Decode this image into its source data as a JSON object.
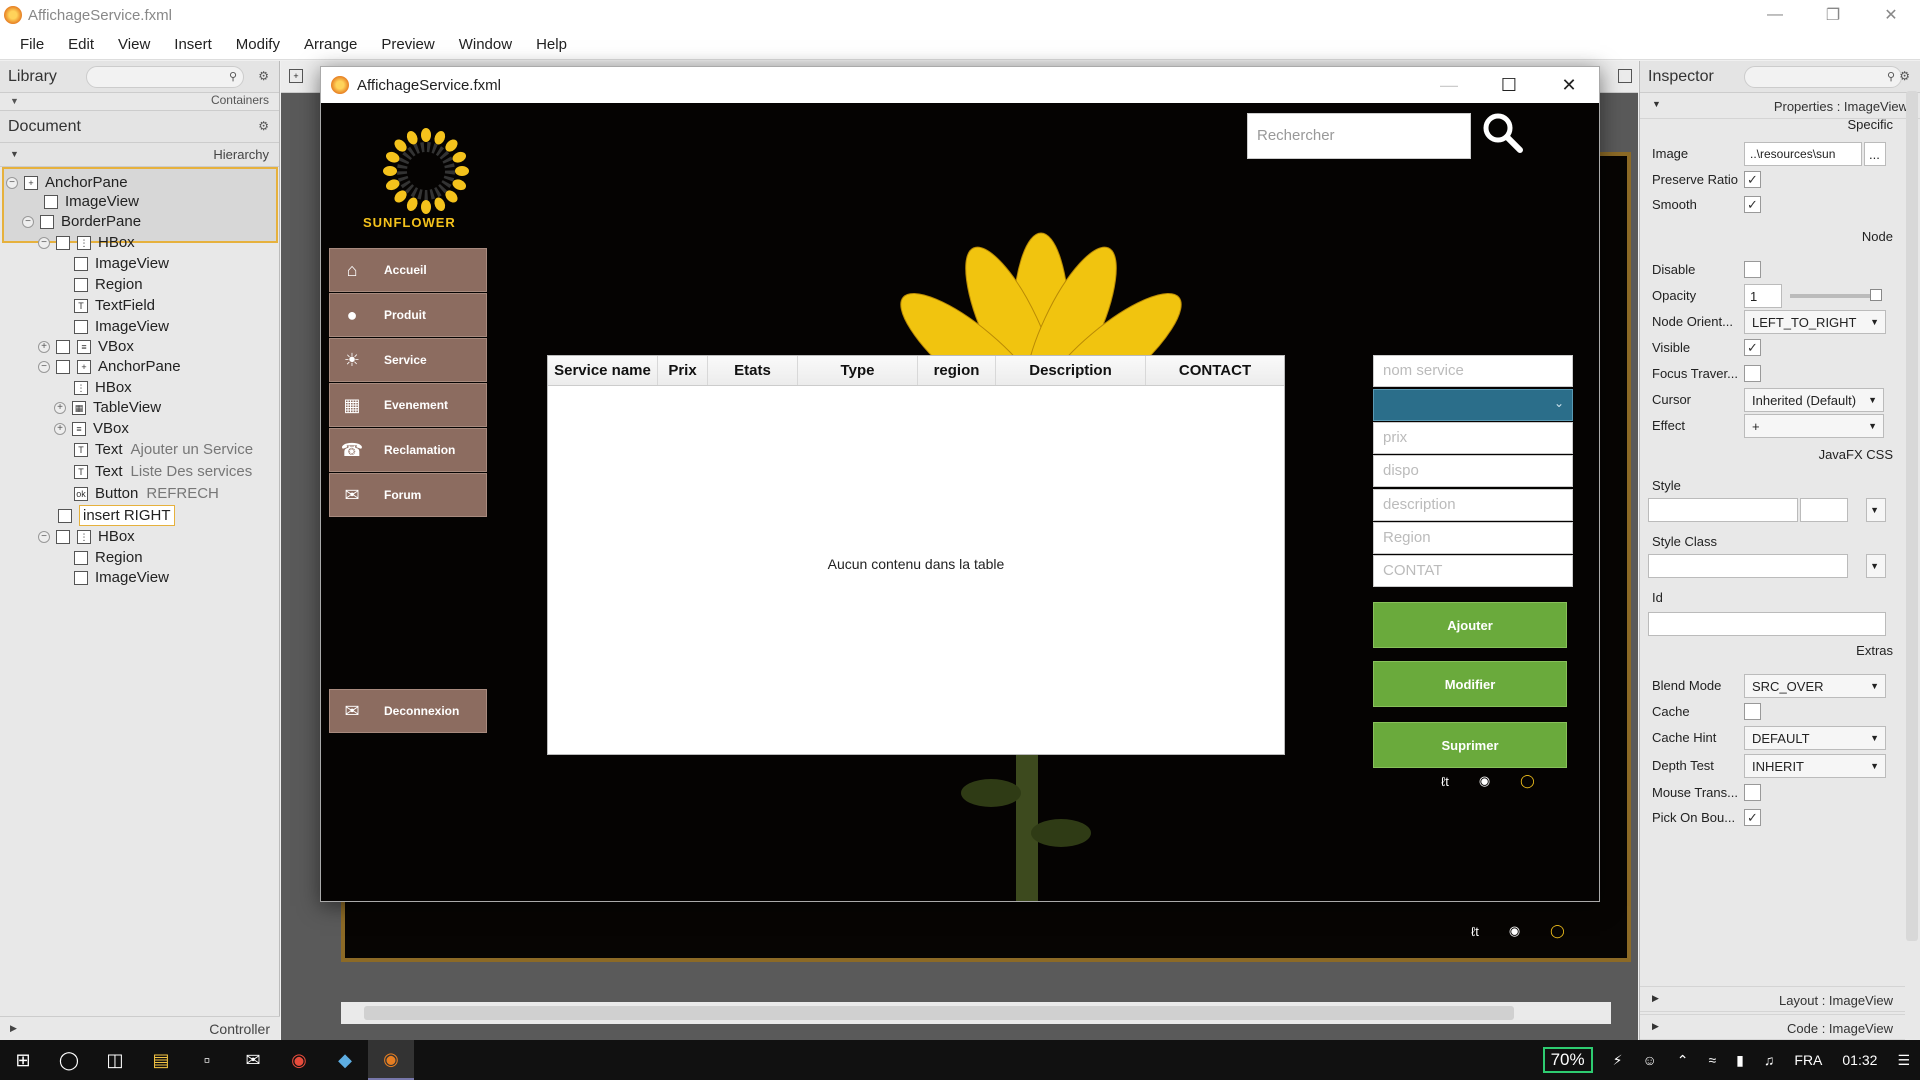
{
  "window": {
    "title": "AffichageService.fxml"
  },
  "menu": [
    "File",
    "Edit",
    "View",
    "Insert",
    "Modify",
    "Arrange",
    "Preview",
    "Window",
    "Help"
  ],
  "library": {
    "title": "Library",
    "sub": "Containers"
  },
  "document": {
    "title": "Document",
    "hierarchy_label": "Hierarchy",
    "tree": [
      {
        "label": "AnchorPane",
        "sub": ""
      },
      {
        "label": "ImageView",
        "sub": ""
      },
      {
        "label": "BorderPane",
        "sub": ""
      },
      {
        "label": "HBox",
        "sub": ""
      },
      {
        "label": "ImageView",
        "sub": ""
      },
      {
        "label": "Region",
        "sub": ""
      },
      {
        "label": "TextField",
        "sub": ""
      },
      {
        "label": "ImageView",
        "sub": ""
      },
      {
        "label": "VBox",
        "sub": ""
      },
      {
        "label": "AnchorPane",
        "sub": ""
      },
      {
        "label": "HBox",
        "sub": ""
      },
      {
        "label": "TableView",
        "sub": ""
      },
      {
        "label": "VBox",
        "sub": ""
      },
      {
        "label": "Text",
        "sub": "Ajouter un Service"
      },
      {
        "label": "Text",
        "sub": "Liste Des services"
      },
      {
        "label": "Button",
        "sub": "REFRECH"
      },
      {
        "label": "insert RIGHT",
        "sub": ""
      },
      {
        "label": "HBox",
        "sub": ""
      },
      {
        "label": "Region",
        "sub": ""
      },
      {
        "label": "ImageView",
        "sub": ""
      }
    ],
    "controller_label": "Controller"
  },
  "preview": {
    "title": "AffichageService.fxml",
    "logo_text": "SUNFLOWER",
    "search_placeholder": "Rechercher",
    "nav": [
      "Accueil",
      "Produit",
      "Service",
      "Evenement",
      "Reclamation",
      "Forum"
    ],
    "logout": "Deconnexion",
    "table": {
      "columns": [
        "Service name",
        "Prix",
        "Etats",
        "Type",
        "region",
        "Description",
        "CONTACT"
      ],
      "empty_message": "Aucun contenu dans la table"
    },
    "form": {
      "placeholders": [
        "nom service",
        "prix",
        "dispo",
        "description",
        "Region",
        "CONTAT"
      ]
    },
    "actions": [
      "Ajouter",
      "Modifier",
      "Suprimer"
    ],
    "colors": {
      "nav": "#8c6c60",
      "action": "#6aaa3c",
      "combo": "#2b6e8a",
      "accent": "#f4c21c"
    }
  },
  "inspector": {
    "title": "Inspector",
    "properties_header": "Properties : ImageView",
    "specific": "Specific",
    "image_label": "Image",
    "image_value": "..\\resources\\sun",
    "preserve_ratio": "Preserve Ratio",
    "smooth": "Smooth",
    "node": "Node",
    "disable": "Disable",
    "opacity": "Opacity",
    "opacity_value": "1",
    "node_orientation": "Node Orient...",
    "node_orientation_value": "LEFT_TO_RIGHT",
    "visible": "Visible",
    "focus": "Focus Traver...",
    "cursor": "Cursor",
    "cursor_value": "Inherited (Default)",
    "effect": "Effect",
    "effect_value": "+",
    "javafx_css": "JavaFX CSS",
    "style": "Style",
    "style_class": "Style Class",
    "id": "Id",
    "extras": "Extras",
    "blend_mode": "Blend Mode",
    "blend_mode_value": "SRC_OVER",
    "cache": "Cache",
    "cache_hint": "Cache Hint",
    "cache_hint_value": "DEFAULT",
    "depth_test": "Depth Test",
    "depth_test_value": "INHERIT",
    "mouse_trans": "Mouse Trans...",
    "pick_on_bounds": "Pick On Bou...",
    "layout_header": "Layout : ImageView",
    "code_header": "Code : ImageView"
  },
  "taskbar": {
    "battery": "70%",
    "lang": "FRA",
    "time": "01:32"
  }
}
